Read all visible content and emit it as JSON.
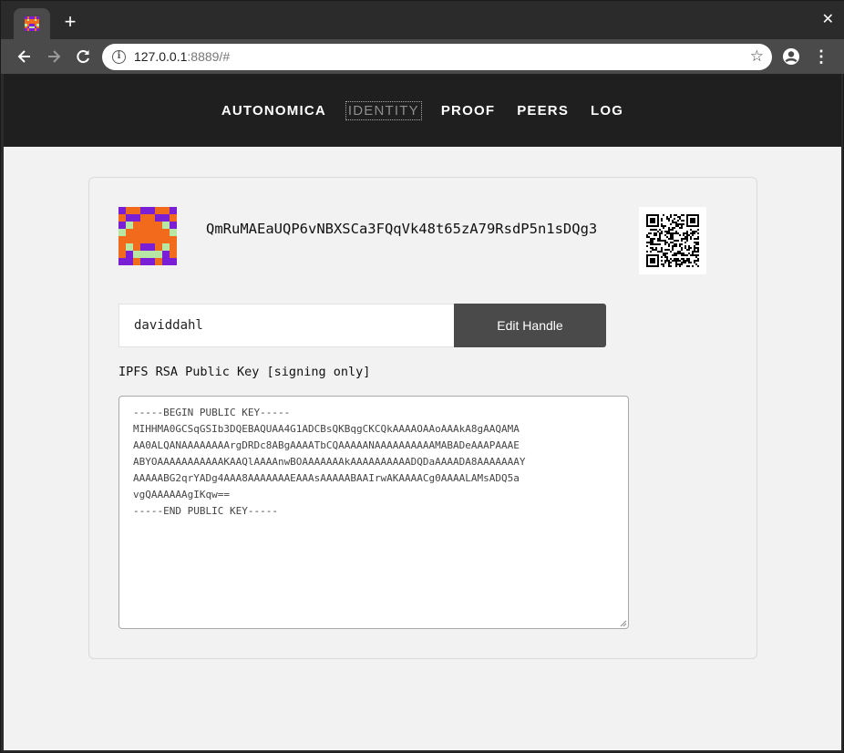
{
  "browser": {
    "new_tab_symbol": "+",
    "close_symbol": "✕",
    "url_host": "127.0.0.1",
    "url_rest": ":8889/#",
    "back_icon": "arrow-left-icon",
    "forward_icon": "arrow-right-icon",
    "reload_icon": "reload-icon",
    "star_icon": "star-icon",
    "account_icon": "account-icon",
    "menu_icon": "kebab-menu-icon"
  },
  "nav": {
    "items": [
      "AUTONOMICA",
      "IDENTITY",
      "PROOF",
      "PEERS",
      "LOG"
    ],
    "active": "IDENTITY"
  },
  "identity": {
    "peer_id": "QmRuMAEaUQP6vNBXSCa3FQqVk48t65zA79RsdP5n1sDQg3",
    "handle_value": "daviddahl",
    "edit_handle_label": "Edit Handle",
    "public_key_label": "IPFS RSA Public Key [signing only]",
    "public_key_text": "-----BEGIN PUBLIC KEY-----\nMIHHMA0GCSqGSIb3DQEBAQUAA4G1ADCBsQKBqgCKCQkAAAAOAAoAAAkA8gAAQAMA\nAA0ALQANAAAAAAAArgDRDc8ABgAAAATbCQAAAAANAAAAAAAAAAMABADeAAAPAAAE\nABYOAAAAAAAAAAAKAAQlAAAAnwBOAAAAAAAkAAAAAAAAAADQDaAAAADA8AAAAAAAY\nAAAAABG2qrYADg4AAA8AAAAAAAEAAAsAAAAABAAIrwAKAAAACg0AAAALAMsADQ5a\nvgQAAAAAAgIKqw==\n-----END PUBLIC KEY-----"
  },
  "colors": {
    "nav_bg": "#1f1f1f",
    "page_bg": "#f2f2f2",
    "button_bg": "#4a4a4a",
    "avatar_purple": "#7a1fd6",
    "avatar_orange": "#f26b1d",
    "avatar_green": "#b7e6a5"
  }
}
